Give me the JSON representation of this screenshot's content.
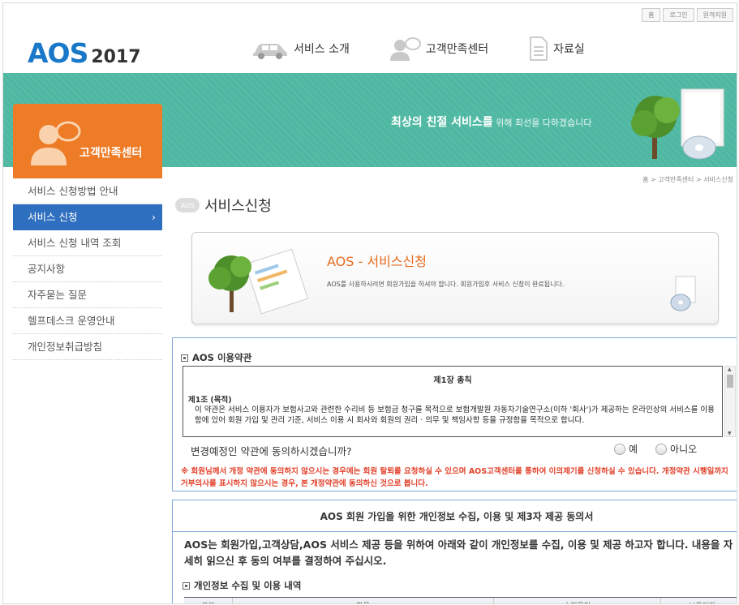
{
  "util_links": [
    "홈",
    "로그인",
    "원격지원"
  ],
  "logo": {
    "name": "AOS",
    "year": "2017"
  },
  "gnb": [
    {
      "label": "서비스 소개",
      "icon": "car-icon"
    },
    {
      "label": "고객만족센터",
      "icon": "person-bubble-icon"
    },
    {
      "label": "자료실",
      "icon": "document-icon"
    }
  ],
  "banner": {
    "slogan_bold": "최상의 친절 서비스를",
    "slogan_rest": " 위해 최선을 다하겠습니다"
  },
  "sidebar": {
    "title": "고객만족센터",
    "items": [
      {
        "label": "서비스 신청방법 안내"
      },
      {
        "label": "서비스 신청"
      },
      {
        "label": "서비스 신청 내역 조회"
      },
      {
        "label": "공지사항"
      },
      {
        "label": "자주묻는 질문"
      },
      {
        "label": "헬프데스크 운영안내"
      },
      {
        "label": "개인정보취급방침"
      }
    ],
    "active_index": 1
  },
  "breadcrumb": "홈 > 고객만족센터 > 서비스신청",
  "page": {
    "badge": "AOS",
    "title": "서비스신청"
  },
  "intro": {
    "heading": "AOS - 서비스신청",
    "text": "AOS를 사용하시려면 회원가입을 하셔야 합니다. 회원가입후 서비스 신청이 완료됩니다."
  },
  "terms": {
    "heading": "AOS 이용약관",
    "chapter": "제1장 총칙",
    "article": "제1조 (목적)",
    "body": "이 약관은 서비스 이용자가 보험사고와 관련한 수리비 등 보험금 청구를 목적으로 보험개발원 자동차기술연구소(이하 '회사')가 제공하는 온라인상의 서비스를 이용함에 있어 회원 가입 및 관리 기준, 서비스 이용 시 회사와 회원의 권리 · 의무 및 책임사항 등을 규정함을 목적으로 합니다.",
    "question": "변경예정인 약관에 동의하시겠습니까?",
    "yes": "예",
    "no": "아니오",
    "warning": "※ 회원님께서 개정 약관에 동의하지 않으시는 경우에는 회원 탈퇴를 요청하실 수 있으며 AOS고객센터를 통하여 이의제기를 신청하실 수 있습니다. 개정약관 시행일까지 거부의사를 표시하지 않으시는 경우, 본 개정약관에 동의하신 것으로 봅니다."
  },
  "privacy": {
    "title": "AOS 회원 가입을 위한 개인정보 수집, 이용 및 제3자 제공 동의서",
    "intro": "AOS는 회원가입,고객상담,AOS 서비스 제공 등을 위하여 아래와 같이 개인정보를 수집, 이용 및 제공 하고자 합니다. 내용을 자세히 읽으신 후 동의 여부를 결정하여 주십시오.",
    "sub_heading": "개인정보 수집 및 이용 내역",
    "columns": [
      "구분",
      "항목",
      "수집목적",
      "보유기간"
    ]
  },
  "colors": {
    "brand_blue": "#1a78c8",
    "banner": "#4fb8a2",
    "sidebar_head": "#ee7b26",
    "active_nav": "#2f6fbf",
    "warning": "#e2432c"
  }
}
